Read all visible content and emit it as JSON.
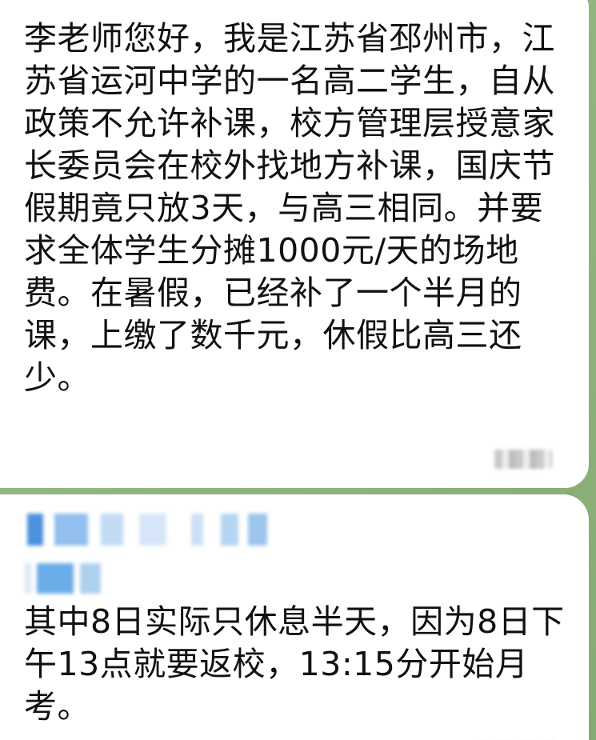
{
  "messages": [
    {
      "text": "李老师您好，我是江苏省邳州市，江苏省运河中学的一名高二学生，自从政策不允许补课，校方管理层授意家长委员会在校外找地方补课，国庆节假期竟只放3天，与高三相同。并要求全体学生分摊1000元/天的场地费。在暑假，已经补了一个半月的课，上缴了数千元，休假比高三还少。"
    },
    {
      "text": "其中8日实际只休息半天，因为8日下午13点就要返校，13:15分开始月考。"
    }
  ],
  "colors": {
    "wallpaper": "#8fb27a",
    "bubble": "#ffffff",
    "text": "#111111",
    "sender_accent": "#2e7fd6"
  }
}
